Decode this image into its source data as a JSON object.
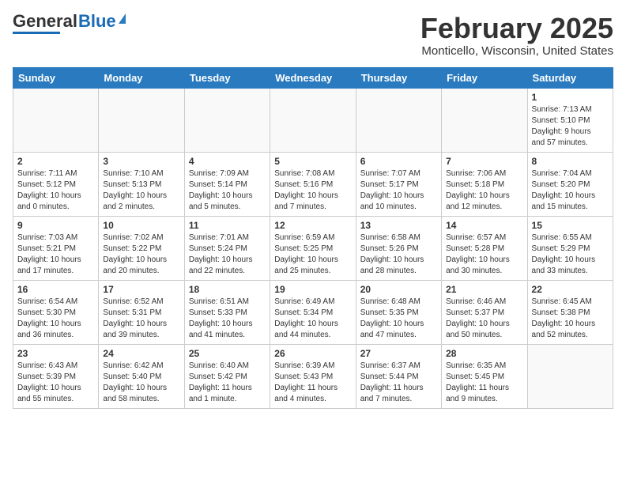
{
  "header": {
    "logo_general": "General",
    "logo_blue": "Blue",
    "month_title": "February 2025",
    "location": "Monticello, Wisconsin, United States"
  },
  "weekdays": [
    "Sunday",
    "Monday",
    "Tuesday",
    "Wednesday",
    "Thursday",
    "Friday",
    "Saturday"
  ],
  "weeks": [
    [
      {
        "day": "",
        "info": ""
      },
      {
        "day": "",
        "info": ""
      },
      {
        "day": "",
        "info": ""
      },
      {
        "day": "",
        "info": ""
      },
      {
        "day": "",
        "info": ""
      },
      {
        "day": "",
        "info": ""
      },
      {
        "day": "1",
        "info": "Sunrise: 7:13 AM\nSunset: 5:10 PM\nDaylight: 9 hours\nand 57 minutes."
      }
    ],
    [
      {
        "day": "2",
        "info": "Sunrise: 7:11 AM\nSunset: 5:12 PM\nDaylight: 10 hours\nand 0 minutes."
      },
      {
        "day": "3",
        "info": "Sunrise: 7:10 AM\nSunset: 5:13 PM\nDaylight: 10 hours\nand 2 minutes."
      },
      {
        "day": "4",
        "info": "Sunrise: 7:09 AM\nSunset: 5:14 PM\nDaylight: 10 hours\nand 5 minutes."
      },
      {
        "day": "5",
        "info": "Sunrise: 7:08 AM\nSunset: 5:16 PM\nDaylight: 10 hours\nand 7 minutes."
      },
      {
        "day": "6",
        "info": "Sunrise: 7:07 AM\nSunset: 5:17 PM\nDaylight: 10 hours\nand 10 minutes."
      },
      {
        "day": "7",
        "info": "Sunrise: 7:06 AM\nSunset: 5:18 PM\nDaylight: 10 hours\nand 12 minutes."
      },
      {
        "day": "8",
        "info": "Sunrise: 7:04 AM\nSunset: 5:20 PM\nDaylight: 10 hours\nand 15 minutes."
      }
    ],
    [
      {
        "day": "9",
        "info": "Sunrise: 7:03 AM\nSunset: 5:21 PM\nDaylight: 10 hours\nand 17 minutes."
      },
      {
        "day": "10",
        "info": "Sunrise: 7:02 AM\nSunset: 5:22 PM\nDaylight: 10 hours\nand 20 minutes."
      },
      {
        "day": "11",
        "info": "Sunrise: 7:01 AM\nSunset: 5:24 PM\nDaylight: 10 hours\nand 22 minutes."
      },
      {
        "day": "12",
        "info": "Sunrise: 6:59 AM\nSunset: 5:25 PM\nDaylight: 10 hours\nand 25 minutes."
      },
      {
        "day": "13",
        "info": "Sunrise: 6:58 AM\nSunset: 5:26 PM\nDaylight: 10 hours\nand 28 minutes."
      },
      {
        "day": "14",
        "info": "Sunrise: 6:57 AM\nSunset: 5:28 PM\nDaylight: 10 hours\nand 30 minutes."
      },
      {
        "day": "15",
        "info": "Sunrise: 6:55 AM\nSunset: 5:29 PM\nDaylight: 10 hours\nand 33 minutes."
      }
    ],
    [
      {
        "day": "16",
        "info": "Sunrise: 6:54 AM\nSunset: 5:30 PM\nDaylight: 10 hours\nand 36 minutes."
      },
      {
        "day": "17",
        "info": "Sunrise: 6:52 AM\nSunset: 5:31 PM\nDaylight: 10 hours\nand 39 minutes."
      },
      {
        "day": "18",
        "info": "Sunrise: 6:51 AM\nSunset: 5:33 PM\nDaylight: 10 hours\nand 41 minutes."
      },
      {
        "day": "19",
        "info": "Sunrise: 6:49 AM\nSunset: 5:34 PM\nDaylight: 10 hours\nand 44 minutes."
      },
      {
        "day": "20",
        "info": "Sunrise: 6:48 AM\nSunset: 5:35 PM\nDaylight: 10 hours\nand 47 minutes."
      },
      {
        "day": "21",
        "info": "Sunrise: 6:46 AM\nSunset: 5:37 PM\nDaylight: 10 hours\nand 50 minutes."
      },
      {
        "day": "22",
        "info": "Sunrise: 6:45 AM\nSunset: 5:38 PM\nDaylight: 10 hours\nand 52 minutes."
      }
    ],
    [
      {
        "day": "23",
        "info": "Sunrise: 6:43 AM\nSunset: 5:39 PM\nDaylight: 10 hours\nand 55 minutes."
      },
      {
        "day": "24",
        "info": "Sunrise: 6:42 AM\nSunset: 5:40 PM\nDaylight: 10 hours\nand 58 minutes."
      },
      {
        "day": "25",
        "info": "Sunrise: 6:40 AM\nSunset: 5:42 PM\nDaylight: 11 hours\nand 1 minute."
      },
      {
        "day": "26",
        "info": "Sunrise: 6:39 AM\nSunset: 5:43 PM\nDaylight: 11 hours\nand 4 minutes."
      },
      {
        "day": "27",
        "info": "Sunrise: 6:37 AM\nSunset: 5:44 PM\nDaylight: 11 hours\nand 7 minutes."
      },
      {
        "day": "28",
        "info": "Sunrise: 6:35 AM\nSunset: 5:45 PM\nDaylight: 11 hours\nand 9 minutes."
      },
      {
        "day": "",
        "info": ""
      }
    ]
  ]
}
